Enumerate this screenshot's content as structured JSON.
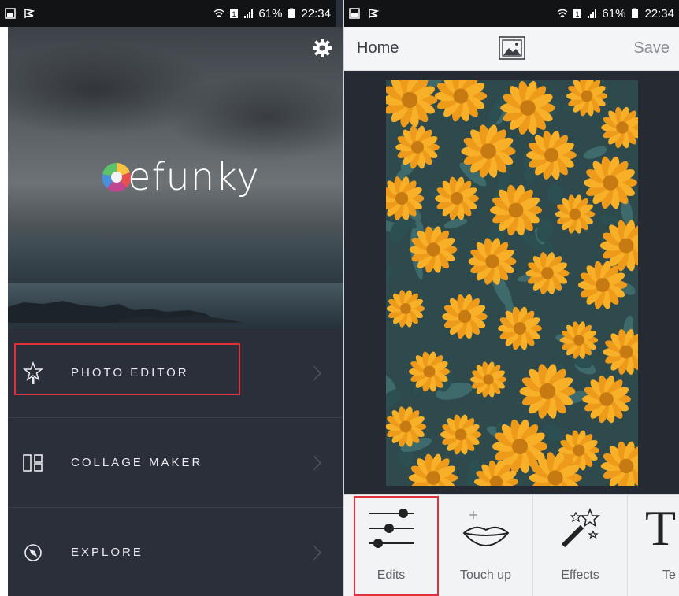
{
  "left_screen": {
    "status_bar": {
      "battery": "61%",
      "time": "22:34"
    },
    "logo": {
      "text": "efunky",
      "full_name": "befunky"
    },
    "menu": [
      {
        "label": "PHOTO EDITOR",
        "icon": "star-wand-icon"
      },
      {
        "label": "COLLAGE MAKER",
        "icon": "collage-grid-icon"
      },
      {
        "label": "EXPLORE",
        "icon": "compass-icon"
      }
    ]
  },
  "right_screen": {
    "status_bar": {
      "battery": "61%",
      "time": "22:34"
    },
    "topbar": {
      "home": "Home",
      "save": "Save"
    },
    "tools": [
      {
        "label": "Edits",
        "icon": "sliders-icon"
      },
      {
        "label": "Touch up",
        "icon": "lips-icon"
      },
      {
        "label": "Effects",
        "icon": "magic-wand-icon"
      },
      {
        "label": "Te",
        "icon": "text-icon"
      }
    ]
  },
  "colors": {
    "highlight": "#e0313a",
    "left_background": "#2b2f3a",
    "flower": "#f5a623"
  }
}
